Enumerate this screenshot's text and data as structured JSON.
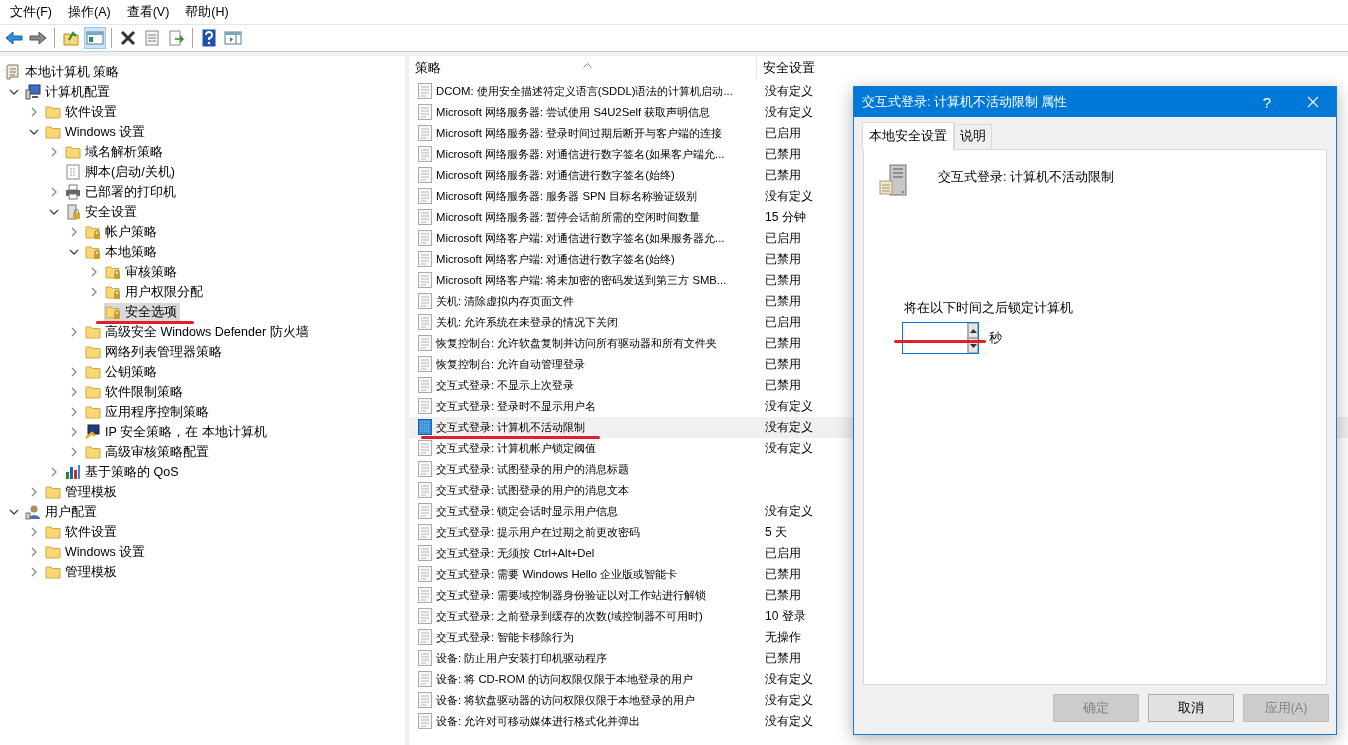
{
  "menu": [
    {
      "label": "文件(F)"
    },
    {
      "label": "操作(A)"
    },
    {
      "label": "查看(V)"
    },
    {
      "label": "帮助(H)"
    }
  ],
  "toolbar": [
    {
      "kind": "back"
    },
    {
      "kind": "forward"
    },
    {
      "kind": "sep"
    },
    {
      "kind": "up"
    },
    {
      "kind": "tree",
      "pressed": true
    },
    {
      "kind": "sep"
    },
    {
      "kind": "delete"
    },
    {
      "kind": "properties"
    },
    {
      "kind": "export"
    },
    {
      "kind": "sep"
    },
    {
      "kind": "help"
    },
    {
      "kind": "pane"
    }
  ],
  "tree": [
    {
      "label": "本地计算机 策略",
      "kind": "policy",
      "selected": false,
      "children": [
        {
          "label": "计算机配置",
          "kind": "computer",
          "expanded": true,
          "selected": false,
          "children": [
            {
              "label": "软件设置",
              "kind": "folder",
              "expanded": false,
              "selected": false
            },
            {
              "label": "Windows 设置",
              "kind": "folder",
              "expanded": true,
              "selected": false,
              "children": [
                {
                  "label": "域名解析策略",
                  "kind": "folder",
                  "expanded": false,
                  "selected": false
                },
                {
                  "label": "脚本(启动/关机)",
                  "kind": "script",
                  "selected": false
                },
                {
                  "label": "已部署的打印机",
                  "kind": "printer",
                  "expanded": false,
                  "selected": false
                },
                {
                  "label": "安全设置",
                  "kind": "security",
                  "expanded": true,
                  "selected": false,
                  "children": [
                    {
                      "label": "帐户策略",
                      "kind": "lockfolder",
                      "expanded": false,
                      "selected": false
                    },
                    {
                      "label": "本地策略",
                      "kind": "lockfolder",
                      "expanded": true,
                      "selected": false,
                      "children": [
                        {
                          "label": "审核策略",
                          "kind": "lockfolder",
                          "expanded": false,
                          "selected": false
                        },
                        {
                          "label": "用户权限分配",
                          "kind": "lockfolder",
                          "expanded": false,
                          "selected": false
                        },
                        {
                          "label": "安全选项",
                          "kind": "lockfolder",
                          "selected": true,
                          "annotated": true
                        }
                      ]
                    },
                    {
                      "label": "高级安全 Windows Defender 防火墙",
                      "kind": "folder",
                      "expanded": false,
                      "selected": false
                    },
                    {
                      "label": "网络列表管理器策略",
                      "kind": "folder",
                      "selected": false
                    },
                    {
                      "label": "公钥策略",
                      "kind": "folder",
                      "expanded": false,
                      "selected": false
                    },
                    {
                      "label": "软件限制策略",
                      "kind": "folder",
                      "expanded": false,
                      "selected": false
                    },
                    {
                      "label": "应用程序控制策略",
                      "kind": "folder",
                      "expanded": false,
                      "selected": false
                    },
                    {
                      "label": "IP 安全策略，在 本地计算机",
                      "kind": "ip",
                      "expanded": false,
                      "selected": false
                    },
                    {
                      "label": "高级审核策略配置",
                      "kind": "folder",
                      "expanded": false,
                      "selected": false
                    }
                  ]
                },
                {
                  "label": "基于策略的 QoS",
                  "kind": "qos",
                  "expanded": false,
                  "selected": false
                }
              ]
            },
            {
              "label": "管理模板",
              "kind": "folder",
              "expanded": false,
              "selected": false
            }
          ]
        },
        {
          "label": "用户配置",
          "kind": "user",
          "expanded": true,
          "selected": false,
          "children": [
            {
              "label": "软件设置",
              "kind": "folder",
              "expanded": false,
              "selected": false
            },
            {
              "label": "Windows 设置",
              "kind": "folder",
              "expanded": false,
              "selected": false
            },
            {
              "label": "管理模板",
              "kind": "folder",
              "expanded": false,
              "selected": false
            }
          ]
        }
      ]
    }
  ],
  "list": {
    "columns": [
      "策略",
      "安全设置"
    ],
    "rows": [
      {
        "policy": "DCOM: 使用安全描述符定义语言(SDDL)语法的计算机启动...",
        "setting": "没有定义",
        "selected": false
      },
      {
        "policy": "Microsoft 网络服务器: 尝试使用 S4U2Self 获取声明信息",
        "setting": "没有定义",
        "selected": false
      },
      {
        "policy": "Microsoft 网络服务器: 登录时间过期后断开与客户端的连接",
        "setting": "已启用",
        "selected": false
      },
      {
        "policy": "Microsoft 网络服务器: 对通信进行数字签名(如果客户端允...",
        "setting": "已禁用",
        "selected": false
      },
      {
        "policy": "Microsoft 网络服务器: 对通信进行数字签名(始终)",
        "setting": "已禁用",
        "selected": false
      },
      {
        "policy": "Microsoft 网络服务器: 服务器 SPN 目标名称验证级别",
        "setting": "没有定义",
        "selected": false
      },
      {
        "policy": "Microsoft 网络服务器: 暂停会话前所需的空闲时间数量",
        "setting": "15 分钟",
        "selected": false
      },
      {
        "policy": "Microsoft 网络客户端: 对通信进行数字签名(如果服务器允...",
        "setting": "已启用",
        "selected": false
      },
      {
        "policy": "Microsoft 网络客户端: 对通信进行数字签名(始终)",
        "setting": "已禁用",
        "selected": false
      },
      {
        "policy": "Microsoft 网络客户端: 将未加密的密码发送到第三方 SMB...",
        "setting": "已禁用",
        "selected": false
      },
      {
        "policy": "关机: 清除虚拟内存页面文件",
        "setting": "已禁用",
        "selected": false
      },
      {
        "policy": "关机: 允许系统在未登录的情况下关闭",
        "setting": "已启用",
        "selected": false
      },
      {
        "policy": "恢复控制台: 允许软盘复制并访问所有驱动器和所有文件夹",
        "setting": "已禁用",
        "selected": false
      },
      {
        "policy": "恢复控制台: 允许自动管理登录",
        "setting": "已禁用",
        "selected": false
      },
      {
        "policy": "交互式登录: 不显示上次登录",
        "setting": "已禁用",
        "selected": false
      },
      {
        "policy": "交互式登录: 登录时不显示用户名",
        "setting": "没有定义",
        "selected": false
      },
      {
        "policy": "交互式登录: 计算机不活动限制",
        "setting": "没有定义",
        "selected": true,
        "annotated": true
      },
      {
        "policy": "交互式登录: 计算机帐户锁定阈值",
        "setting": "没有定义",
        "selected": false
      },
      {
        "policy": "交互式登录: 试图登录的用户的消息标题",
        "selected": false
      },
      {
        "policy": "交互式登录: 试图登录的用户的消息文本",
        "selected": false
      },
      {
        "policy": "交互式登录: 锁定会话时显示用户信息",
        "setting": "没有定义",
        "selected": false
      },
      {
        "policy": "交互式登录: 提示用户在过期之前更改密码",
        "setting": "5 天",
        "selected": false
      },
      {
        "policy": "交互式登录: 无须按 Ctrl+Alt+Del",
        "setting": "已启用",
        "selected": false
      },
      {
        "policy": "交互式登录: 需要 Windows Hello 企业版或智能卡",
        "setting": "已禁用",
        "selected": false
      },
      {
        "policy": "交互式登录: 需要域控制器身份验证以对工作站进行解锁",
        "setting": "已禁用",
        "selected": false
      },
      {
        "policy": "交互式登录: 之前登录到缓存的次数(域控制器不可用时)",
        "setting": "10 登录",
        "selected": false
      },
      {
        "policy": "交互式登录: 智能卡移除行为",
        "setting": "无操作",
        "selected": false
      },
      {
        "policy": "设备: 防止用户安装打印机驱动程序",
        "setting": "已禁用",
        "selected": false
      },
      {
        "policy": "设备: 将 CD-ROM 的访问权限仅限于本地登录的用户",
        "setting": "没有定义",
        "selected": false
      },
      {
        "policy": "设备: 将软盘驱动器的访问权限仅限于本地登录的用户",
        "setting": "没有定义",
        "selected": false
      },
      {
        "policy": "设备: 允许对可移动媒体进行格式化并弹出",
        "setting": "没有定义",
        "selected": false
      }
    ]
  },
  "dialog": {
    "title": "交互式登录: 计算机不活动限制 属性",
    "help_button": "?",
    "tabs": [
      {
        "label": "本地安全设置",
        "selected": true
      },
      {
        "label": "说明",
        "selected": false
      }
    ],
    "policy_name": "交互式登录: 计算机不活动限制",
    "field_label": "将在以下时间之后锁定计算机",
    "field_annotated": true,
    "unit": "秒",
    "buttons": [
      {
        "label": "确定",
        "disabled": true
      },
      {
        "label": "取消",
        "disabled": false
      },
      {
        "label": "应用(A)",
        "disabled": true
      }
    ]
  }
}
